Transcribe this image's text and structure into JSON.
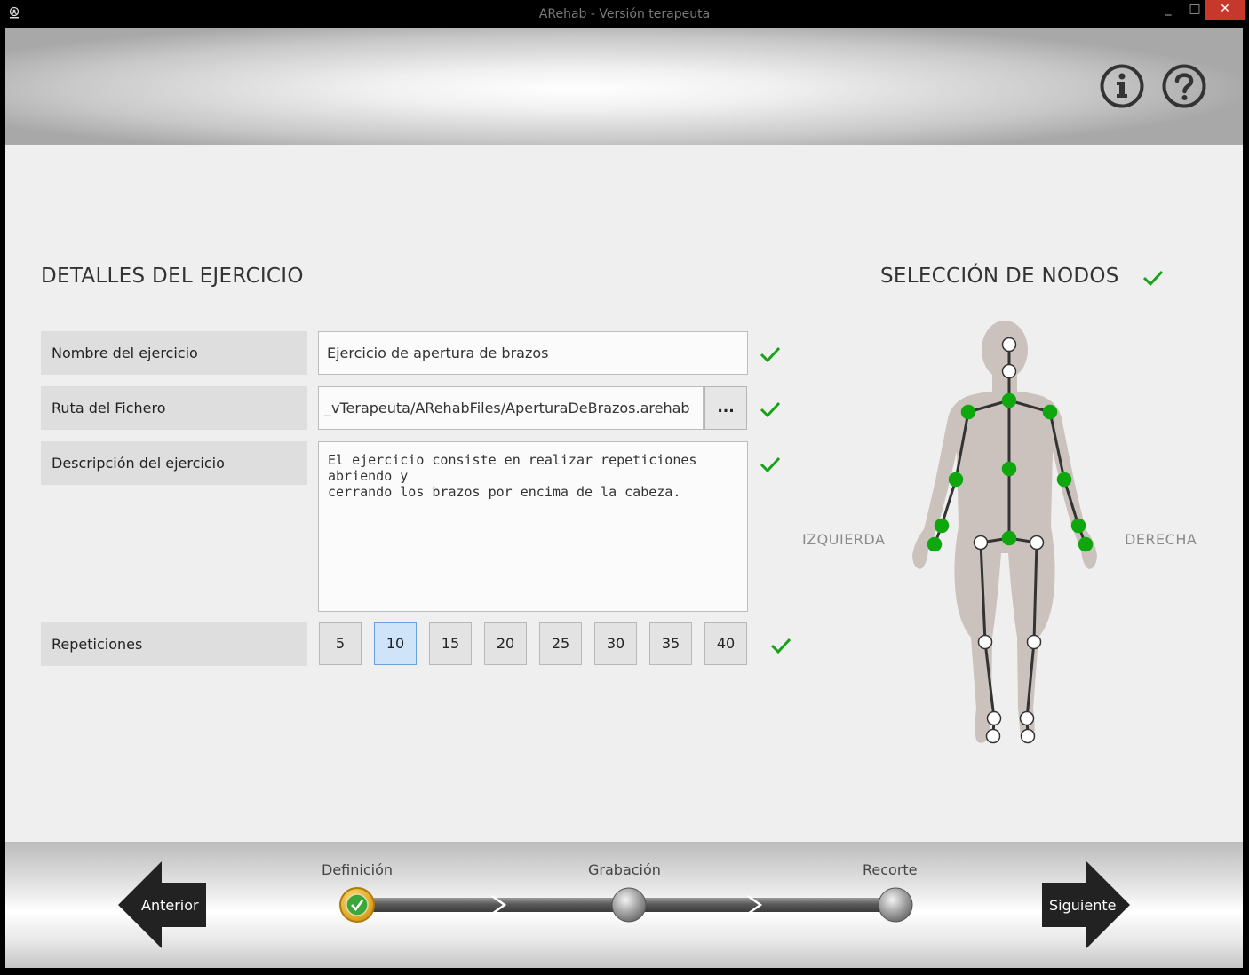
{
  "window": {
    "title": "ARehab - Versión terapeuta",
    "minimize": "_",
    "maximize": "□",
    "close": "✕"
  },
  "header": {
    "info_icon": "info-icon",
    "help_icon": "help-icon"
  },
  "details": {
    "title": "DETALLES DEL EJERCICIO",
    "fields": [
      {
        "label": "Nombre del ejercicio",
        "value": "Ejercicio de apertura de brazos",
        "valid": true
      },
      {
        "label": "Ruta del Fichero",
        "value": "_vTerapeuta/ARehabFiles/AperturaDeBrazos.arehab",
        "valid": true
      },
      {
        "label": "Descripción del ejercicio",
        "value": "El ejercicio consiste en realizar repeticiones abriendo y\ncerrando los brazos por encima de la cabeza.",
        "valid": true
      }
    ],
    "browse_label": "...",
    "repetitions": {
      "label": "Repeticiones",
      "options": [
        "5",
        "10",
        "15",
        "20",
        "25",
        "30",
        "35",
        "40"
      ],
      "selected": "10",
      "valid": true
    }
  },
  "nodes": {
    "title": "SELECCIÓN DE NODOS",
    "valid": true,
    "left_label": "IZQUIERDA",
    "right_label": "DERECHA",
    "selected_color": "#0ea80e",
    "unselected_color": "#ffffff",
    "joints": {
      "head": false,
      "neck": false,
      "spine_shoulder": true,
      "shoulder_left": true,
      "shoulder_right": true,
      "elbow_left": true,
      "elbow_right": true,
      "spine_mid": true,
      "wrist_left": true,
      "wrist_right": true,
      "hand_left": true,
      "hand_right": true,
      "spine_base": true,
      "hip_left": false,
      "hip_right": false,
      "knee_left": false,
      "knee_right": false,
      "ankle_left": false,
      "ankle_right": false,
      "foot_left": false,
      "foot_right": false
    }
  },
  "footer": {
    "prev_label": "Anterior",
    "next_label": "Siguiente",
    "steps": [
      "Definición",
      "Grabación",
      "Recorte"
    ],
    "current_step": 0
  },
  "colors": {
    "valid_check": "#17a317",
    "selected_rep": "#cfe4f8",
    "active_step": "#e0a820"
  }
}
